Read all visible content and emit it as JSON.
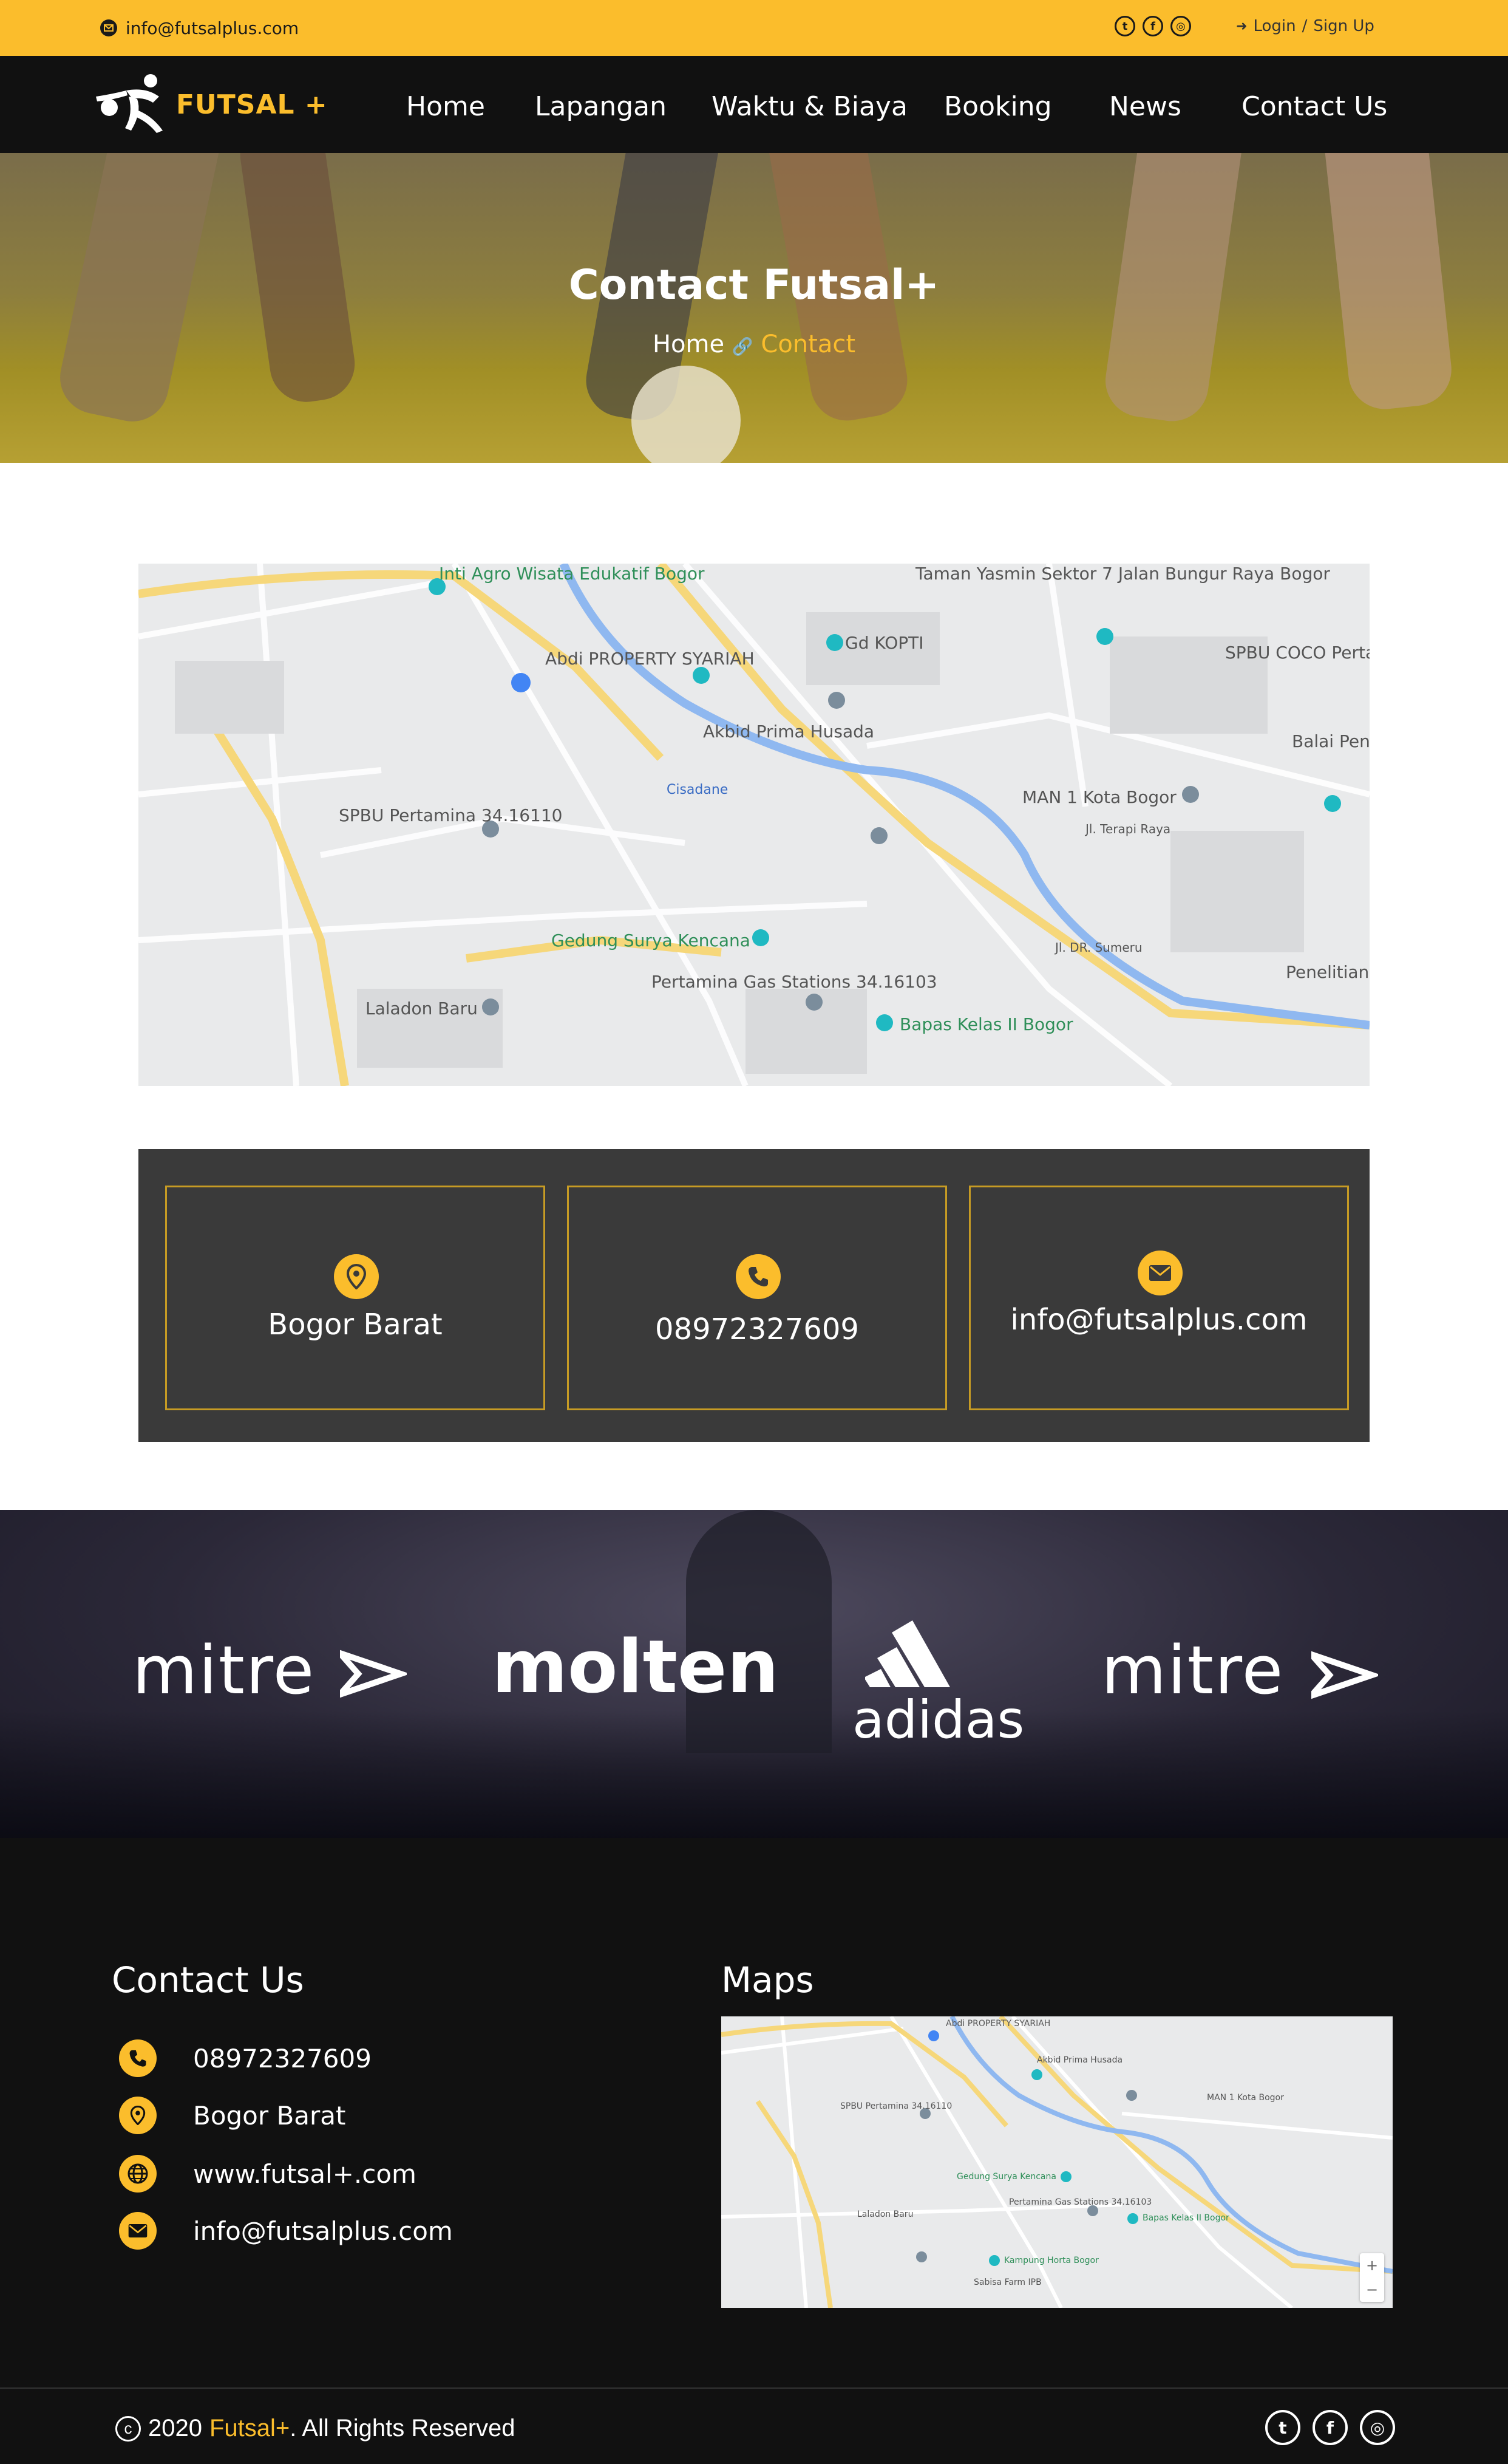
{
  "topbar": {
    "email": "info@futsalplus.com",
    "email_icon": "envelope-icon",
    "social_icons": [
      "twitter-icon",
      "facebook-icon",
      "instagram-icon"
    ],
    "login": "Login",
    "separator": "/",
    "signup": "Sign Up"
  },
  "nav": {
    "logo_text": "FUTSAL +",
    "items": [
      "Home",
      "Lapangan",
      "Waktu & Biaya",
      "Booking",
      "News",
      "Contact Us"
    ]
  },
  "hero": {
    "title": "Contact Futsal+",
    "crumb_home": "Home",
    "crumb_sep": "🔗",
    "crumb_current": "Contact"
  },
  "map": {
    "labels": [
      "Inti Agro Wisata Edukatif Bogor",
      "Taman Yasmin Sektor 7 Jalan Bungur Raya Bogor",
      "Gd KOPTI",
      "Abdi PROPERTY SYARIAH",
      "SPBU COCO Perta - Cimanggu BC",
      "Akbid Prima Husada",
      "Balai Pen Tanaman",
      "MAN 1 Kota Bogor",
      "SPBU Pertamina 34.16110",
      "Cisadane",
      "Jl. Terapi Raya",
      "Gedung Surya Kencana",
      "Pertamina Gas Stations 34.16103",
      "Laladon Baru",
      "Bapas Kelas II Bogor",
      "Jl. DR. Sumeru",
      "Penelitian"
    ]
  },
  "contact_cards": [
    {
      "icon": "map-pin-icon",
      "label": "Bogor Barat"
    },
    {
      "icon": "phone-icon",
      "label": "08972327609"
    },
    {
      "icon": "envelope-icon",
      "label": "info@futsalplus.com"
    }
  ],
  "brands": [
    "mitre",
    "molten",
    "adidas",
    "mitre"
  ],
  "footer": {
    "contact_title": "Contact Us",
    "maps_title": "Maps",
    "rows": [
      {
        "icon": "phone-icon",
        "text": "08972327609"
      },
      {
        "icon": "map-pin-icon",
        "text": "Bogor Barat"
      },
      {
        "icon": "globe-icon",
        "text": "www.futsal+.com"
      },
      {
        "icon": "envelope-icon",
        "text": "info@futsalplus.com"
      }
    ],
    "mini_map_labels": [
      "Abdi PROPERTY SYARIAH",
      "Akbid Prima Husada",
      "SPBU Pertamina 34.16110",
      "MAN 1 Kota Bogor",
      "Gedung Surya Kencana",
      "Pertamina Gas Stations 34.16103",
      "Bapas Kelas II Bogor",
      "Laladon Baru",
      "Kampung Horta Bogor",
      "Sabisa Farm IPB"
    ],
    "copyright_symbol": "c",
    "copyright_year": "2020",
    "copyright_brand": "Futsal+",
    "copyright_rest": ". All Rights Reserved",
    "social_icons": [
      "twitter-icon",
      "facebook-icon",
      "instagram-icon"
    ]
  },
  "colors": {
    "accent": "#fbbd2c",
    "dark": "#111111",
    "card_bg": "#3a3a3a",
    "card_border": "#c69b24"
  }
}
